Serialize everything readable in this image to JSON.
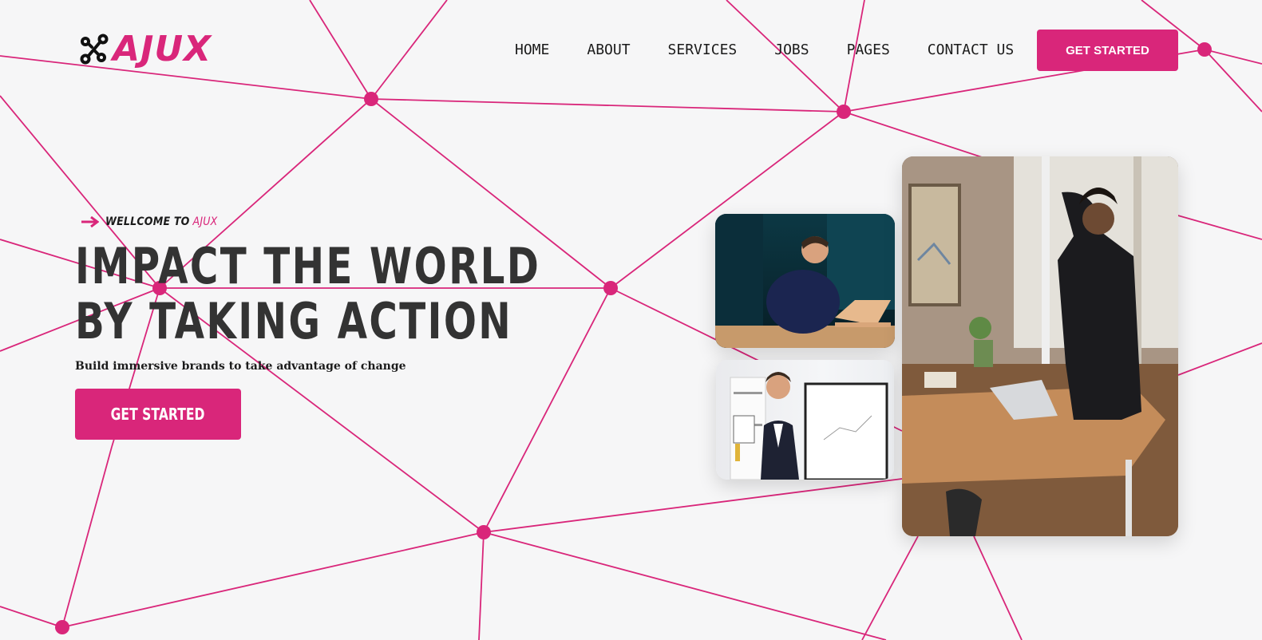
{
  "brand": {
    "name": "AJUX",
    "logo_icon": "circuit-nodes-icon",
    "accent_color": "#d9267a"
  },
  "nav": {
    "items": [
      "HOME",
      "ABOUT",
      "SERVICES",
      "JOBS",
      "PAGES",
      "CONTACT US"
    ],
    "cta_label": "GET STARTED"
  },
  "hero": {
    "eyebrow_prefix": "WELLCOME TO",
    "eyebrow_brand": "AJUX",
    "eyebrow_icon": "arrow-right-icon",
    "headline_line1": "IMPACT THE WORLD",
    "headline_line2": "BY TAKING ACTION",
    "subtitle": "Build immersive brands to take advantage of change",
    "cta_label": "GET STARTED"
  },
  "photos": [
    {
      "name": "man-working-on-laptop-photo"
    },
    {
      "name": "man-presenting-flipchart-photo"
    },
    {
      "name": "man-standing-at-office-desk-photo"
    }
  ],
  "colors": {
    "background": "#f6f6f7",
    "network_lines": "#d9267a",
    "headline": "#333333"
  }
}
